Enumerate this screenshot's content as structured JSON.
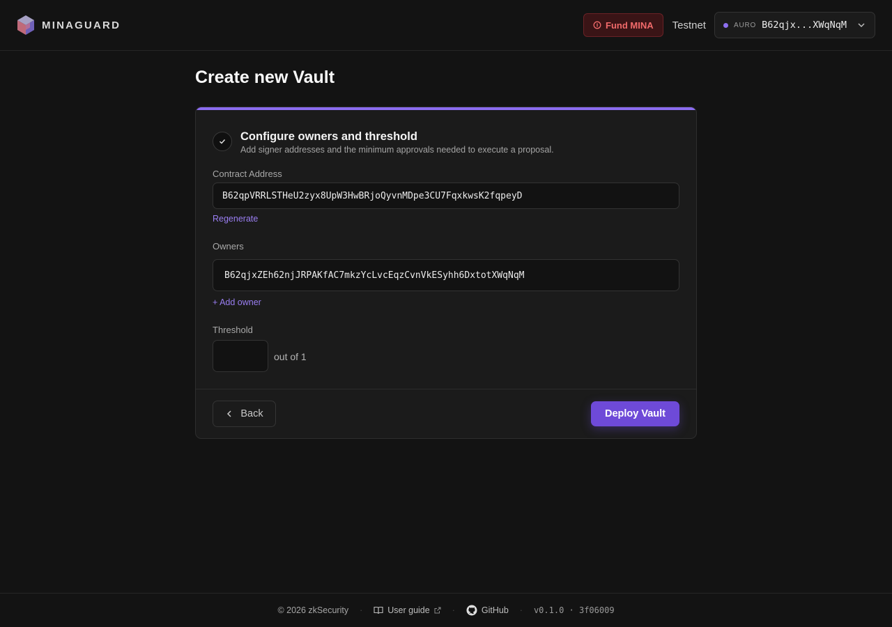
{
  "header": {
    "brand": "MINAGUARD",
    "fund_label": "Fund MINA",
    "network": "Testnet",
    "wallet_tag": "AURO",
    "wallet_address": "B62qjx...XWqNqM"
  },
  "page": {
    "title": "Create new Vault"
  },
  "step": {
    "title": "Configure owners and threshold",
    "subtitle": "Add signer addresses and the minimum approvals needed to execute a proposal."
  },
  "form": {
    "contract_label": "Contract Address",
    "contract_value": "B62qpVRRLSTHeU2zyx8UpW3HwBRjoQyvnMDpe3CU7FqxkwsK2fqpeyD",
    "regenerate_label": "Regenerate",
    "owners_label": "Owners",
    "owners": [
      "B62qjxZEh62njJRPAKfAC7mkzYcLvcEqzCvnVkESyhh6DxtotXWqNqM"
    ],
    "add_owner_label": "+ Add owner",
    "threshold_label": "Threshold",
    "threshold_value": "",
    "out_of": "out of 1"
  },
  "actions": {
    "back_label": "Back",
    "deploy_label": "Deploy Vault"
  },
  "footer": {
    "copyright": "© 2026 zkSecurity",
    "guide_label": "User guide",
    "github_label": "GitHub",
    "version": "v0.1.0 · 3f06009"
  },
  "colors": {
    "accent": "#8b6cf0",
    "deploy": "#6e4ad8",
    "fund": "#f06a6a",
    "background": "#131313"
  }
}
